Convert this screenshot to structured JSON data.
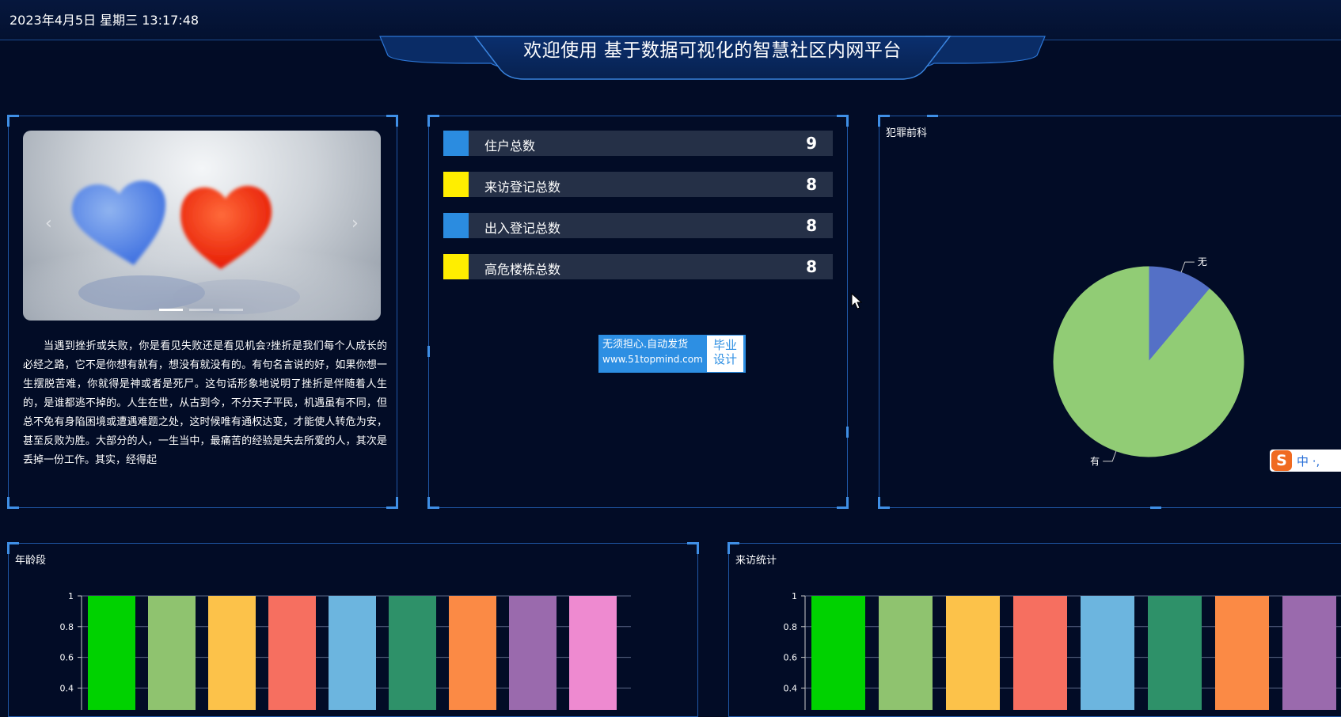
{
  "header": {
    "datetime": "2023年4月5日 星期三 13:17:48",
    "title": "欢迎使用 基于数据可视化的智慧社区内网平台"
  },
  "left_panel": {
    "paragraph": "当遇到挫折或失败，你是看见失败还是看见机会?挫折是我们每个人成长的必经之路，它不是你想有就有，想没有就没有的。有句名言说的好，如果你想一生摆脱苦难，你就得是神或者是死尸。这句话形象地说明了挫折是伴随着人生的，是谁都逃不掉的。人生在世，从古到今，不分天子平民，机遇虽有不同，但总不免有身陷困境或遭遇难题之处，这时候唯有通权达变，才能使人转危为安，甚至反败为胜。大部分的人，一生当中，最痛苦的经验是失去所爱的人，其次是丢掉一份工作。其实，经得起",
    "carousel": {
      "prev": "‹",
      "next": "›"
    }
  },
  "stats": [
    {
      "label": "住户总数",
      "value": "9",
      "color": "#2b8ce0"
    },
    {
      "label": "来访登记总数",
      "value": "8",
      "color": "#ffee00"
    },
    {
      "label": "出入登记总数",
      "value": "8",
      "color": "#2b8ce0"
    },
    {
      "label": "高危楼栋总数",
      "value": "8",
      "color": "#ffee00"
    }
  ],
  "badge": {
    "line1": "无须担心.自动发货",
    "line2": "www.51topmind.com",
    "right1": "毕业",
    "right2": "设计"
  },
  "ime": {
    "logo": "S",
    "text": "中 ·,"
  },
  "charts": {
    "crime": {
      "title": "犯罪前科",
      "type": "pie",
      "slices": [
        {
          "label": "无",
          "value": 1,
          "color": "#5470c6"
        },
        {
          "label": "有",
          "value": 8,
          "color": "#91cc75"
        }
      ]
    },
    "age": {
      "title": "年龄段",
      "type": "bar",
      "yticks": [
        "1",
        "0.8",
        "0.6",
        "0.4"
      ],
      "ylim": [
        0,
        1
      ],
      "values": [
        1,
        1,
        1,
        1,
        1,
        1,
        1,
        1,
        1
      ],
      "colors": [
        "#00d200",
        "#8fc36f",
        "#fcc24a",
        "#f66f60",
        "#6cb5df",
        "#2e9169",
        "#fb8a45",
        "#9a6aad",
        "#ee8ad0"
      ]
    },
    "visit": {
      "title": "来访统计",
      "type": "bar",
      "yticks": [
        "1",
        "0.8",
        "0.6",
        "0.4"
      ],
      "ylim": [
        0,
        1
      ],
      "values": [
        1,
        1,
        1,
        1,
        1,
        1,
        1,
        1
      ],
      "colors": [
        "#00d200",
        "#8fc36f",
        "#fcc24a",
        "#f66f60",
        "#6cb5df",
        "#2e9169",
        "#fb8a45",
        "#9a6aad"
      ]
    }
  },
  "chart_data": [
    {
      "type": "pie",
      "title": "犯罪前科",
      "labels": [
        "无",
        "有"
      ],
      "values": [
        1,
        8
      ]
    },
    {
      "type": "bar",
      "title": "年龄段",
      "values": [
        1,
        1,
        1,
        1,
        1,
        1,
        1,
        1,
        1
      ],
      "ylim": [
        0,
        1
      ]
    },
    {
      "type": "bar",
      "title": "来访统计",
      "values": [
        1,
        1,
        1,
        1,
        1,
        1,
        1,
        1
      ],
      "ylim": [
        0,
        1
      ]
    }
  ]
}
